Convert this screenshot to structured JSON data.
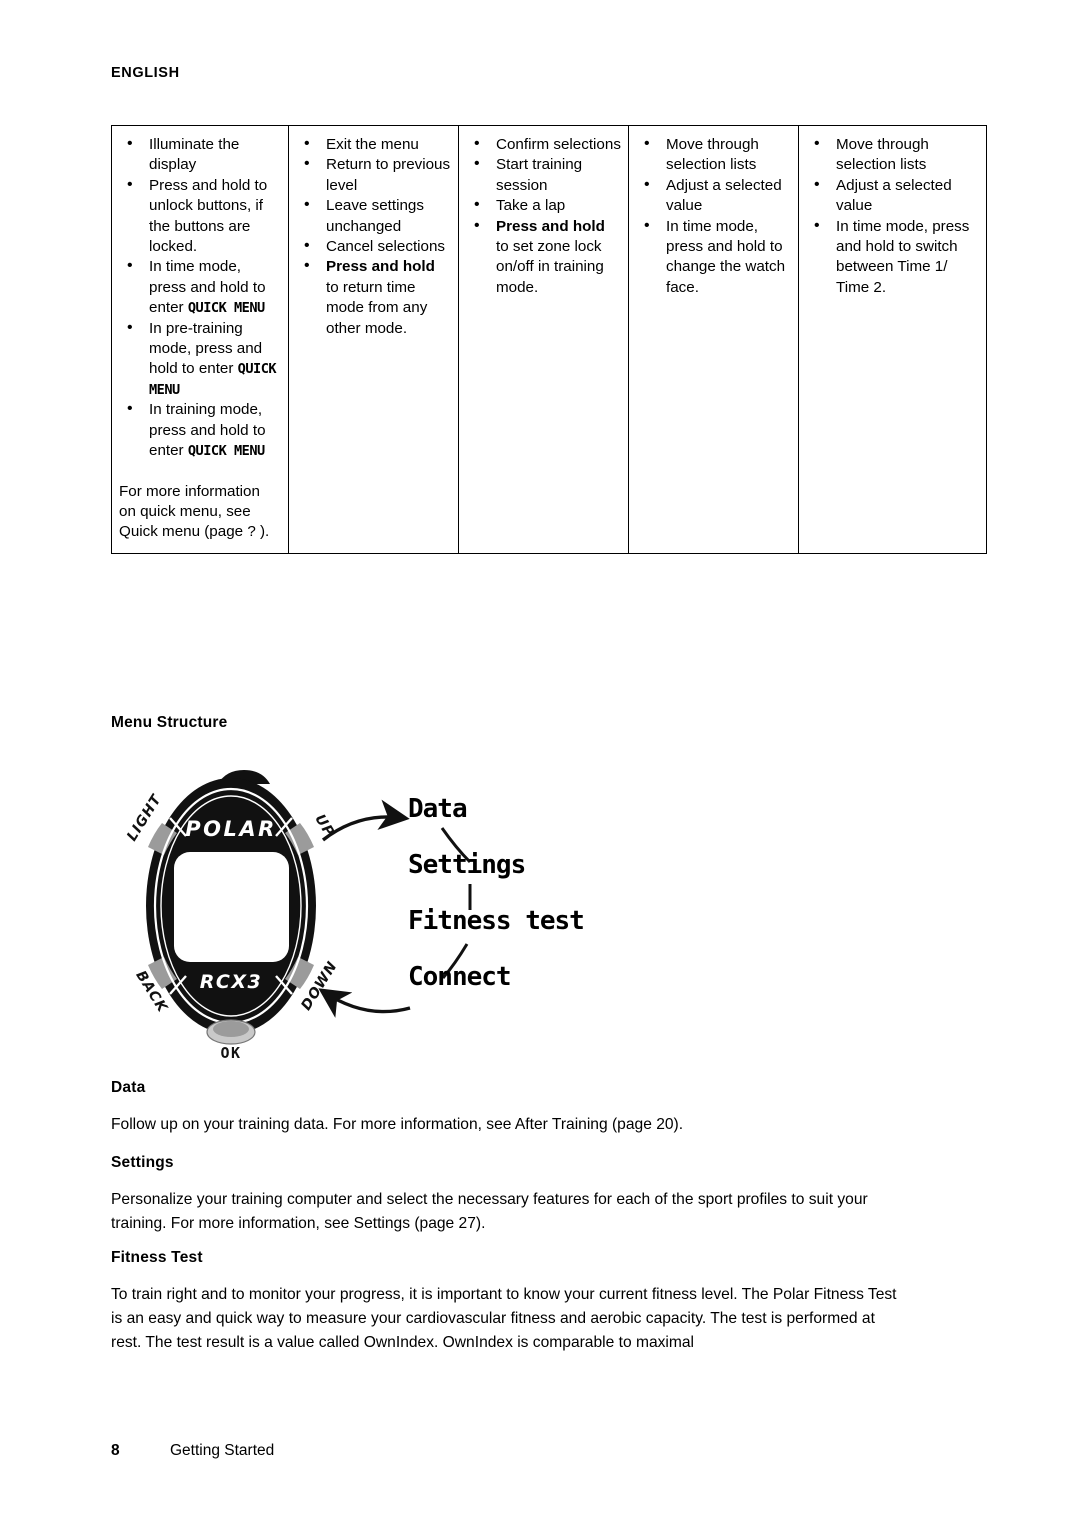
{
  "header": {
    "language": "ENGLISH"
  },
  "button_table": {
    "columns": [
      {
        "id": "light",
        "items": [
          {
            "text": "Illuminate the display"
          },
          {
            "text": "Press and hold to unlock buttons, if the buttons are locked."
          },
          {
            "prefix": "In time mode, press and hold to enter ",
            "lcd": "QUICK MENU"
          },
          {
            "prefix": "In pre-training mode, press and hold to enter ",
            "lcd": "QUICK MENU"
          },
          {
            "prefix": "In training mode, press and hold to enter ",
            "lcd": "QUICK MENU"
          }
        ],
        "note": "For more information on quick menu, see Quick menu (page ? )."
      },
      {
        "id": "back",
        "items": [
          {
            "text": "Exit the menu"
          },
          {
            "text": "Return to previous level"
          },
          {
            "text": "Leave settings unchanged"
          },
          {
            "text": "Cancel selections"
          },
          {
            "bold": "Press and hold",
            "text": " to return time mode from any other mode."
          }
        ]
      },
      {
        "id": "ok",
        "items": [
          {
            "text": "Confirm selections"
          },
          {
            "text": "Start training session"
          },
          {
            "text": "Take a lap"
          },
          {
            "bold": "Press and hold",
            "text": " to set zone lock on/off in training mode."
          }
        ]
      },
      {
        "id": "up",
        "items": [
          {
            "text": "Move through selection lists"
          },
          {
            "text": "Adjust a selected value"
          },
          {
            "text": "In time mode, press and hold to change the watch face."
          }
        ]
      },
      {
        "id": "down",
        "items": [
          {
            "text": "Move through selection lists"
          },
          {
            "text": "Adjust a selected value"
          },
          {
            "text": "In time mode, press and hold to switch between Time 1/ Time 2."
          }
        ]
      }
    ]
  },
  "menu_structure": {
    "heading": "Menu Structure",
    "watch": {
      "brand": "POLAR",
      "model": "RCX3",
      "buttons": {
        "light": "LIGHT",
        "up": "UP",
        "back": "BACK",
        "down": "DOWN",
        "ok": "OK"
      }
    },
    "menu_items": [
      "Data",
      "Settings",
      "Fitness test",
      "Connect"
    ]
  },
  "sections": [
    {
      "heading": "Data",
      "body": "Follow up on your training data. For more information, see After Training (page 20)."
    },
    {
      "heading": "Settings",
      "body": "Personalize your training computer and select the necessary features for each of the sport profiles to suit your training. For more information, see Settings (page 27)."
    },
    {
      "heading": "Fitness Test",
      "body": "To train right and to monitor your progress, it is important to know your current fitness level. The Polar Fitness Test is an easy and quick way to measure your cardiovascular fitness and aerobic capacity. The test is performed at rest. The test result is a value called OwnIndex. OwnIndex is comparable to maximal"
    }
  ],
  "footer": {
    "page_number": "8",
    "section_name": "Getting Started"
  }
}
